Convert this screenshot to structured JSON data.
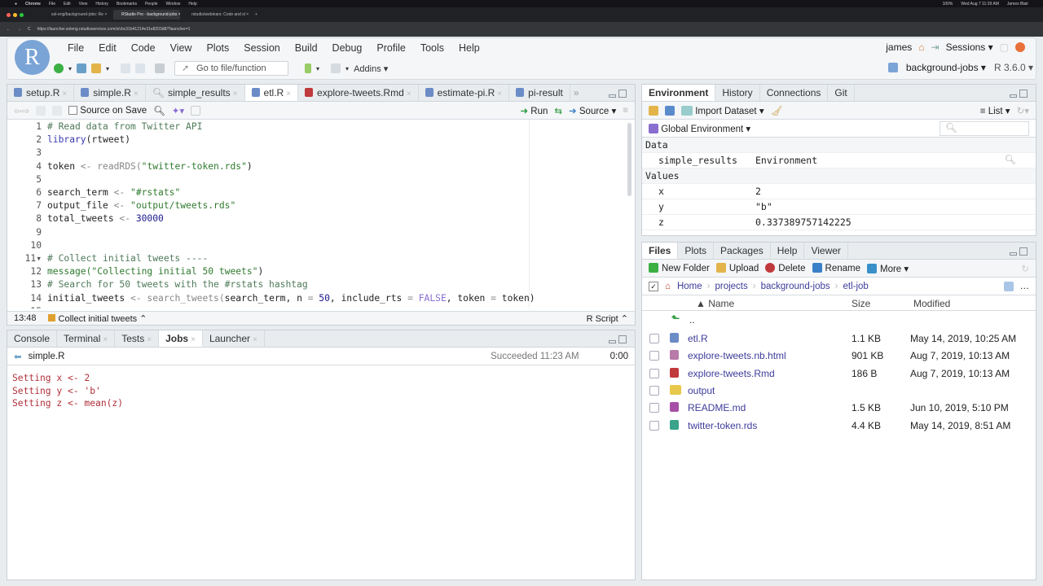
{
  "os": {
    "app": "Chrome",
    "menus": [
      "File",
      "Edit",
      "View",
      "History",
      "Bookmarks",
      "People",
      "Window",
      "Help"
    ],
    "clock": "Wed Aug 7  11:29 AM",
    "battery": "100%",
    "user": "James Blair"
  },
  "browser": {
    "tabs": [
      "sol-eng/background-jobs: Re",
      "RStudio Pro - background-jobs",
      "rstudio/webinars: Code and sl"
    ],
    "url": "https://launcher.soleng.rstudioservices.com/s/cbc31b41214e31e8203d8/?launcher=1"
  },
  "rstudio": {
    "logo": "R",
    "menus": [
      "File",
      "Edit",
      "Code",
      "View",
      "Plots",
      "Session",
      "Build",
      "Debug",
      "Profile",
      "Tools",
      "Help"
    ],
    "goto_placeholder": "Go to file/function",
    "addins": "Addins",
    "user": "james",
    "sessions": "Sessions",
    "project": "background-jobs",
    "r_version": "R 3.6.0"
  },
  "source": {
    "tabs": [
      "setup.R",
      "simple.R",
      "simple_results",
      "etl.R",
      "explore-tweets.Rmd",
      "estimate-pi.R",
      "pi-result"
    ],
    "active_tab": 3,
    "source_on_save": "Source on Save",
    "run": "Run",
    "source_btn": "Source",
    "lines": [
      [
        {
          "t": "# Read data from Twitter API",
          "c": "cm"
        }
      ],
      [
        {
          "t": "library",
          "c": "fn"
        },
        {
          "t": "(rtweet)",
          "c": ""
        }
      ],
      [],
      [
        {
          "t": "token ",
          "c": ""
        },
        {
          "t": "<- readRDS(",
          "c": "op"
        },
        {
          "t": "\"twitter-token.rds\"",
          "c": "st"
        },
        {
          "t": ")",
          "c": ""
        }
      ],
      [],
      [
        {
          "t": "search_term ",
          "c": ""
        },
        {
          "t": "<- ",
          "c": "op"
        },
        {
          "t": "\"#rstats\"",
          "c": "st"
        }
      ],
      [
        {
          "t": "output_file ",
          "c": ""
        },
        {
          "t": "<- ",
          "c": "op"
        },
        {
          "t": "\"output/tweets.rds\"",
          "c": "st"
        }
      ],
      [
        {
          "t": "total_tweets ",
          "c": ""
        },
        {
          "t": "<- ",
          "c": "op"
        },
        {
          "t": "30000",
          "c": "nu"
        }
      ],
      [],
      [],
      [
        {
          "t": "# Collect initial tweets ----",
          "c": "cm"
        }
      ],
      [
        {
          "t": "message(",
          "c": "st"
        },
        {
          "t": "\"Collecting initial 50 tweets\"",
          "c": "st"
        },
        {
          "t": ")",
          "c": ""
        }
      ],
      [
        {
          "t": "# Search for 50 tweets with the #rstats hashtag",
          "c": "cm"
        }
      ],
      [
        {
          "t": "initial_tweets ",
          "c": ""
        },
        {
          "t": "<- search_tweets(",
          "c": "op"
        },
        {
          "t": "search_term, n ",
          "c": ""
        },
        {
          "t": "= ",
          "c": "op"
        },
        {
          "t": "50",
          "c": "nu"
        },
        {
          "t": ", include_rts ",
          "c": ""
        },
        {
          "t": "= ",
          "c": "op"
        },
        {
          "t": "FALSE",
          "c": "kw"
        },
        {
          "t": ", token ",
          "c": ""
        },
        {
          "t": "= ",
          "c": "op"
        },
        {
          "t": "token)",
          "c": ""
        }
      ]
    ],
    "fold_line": 11,
    "status": {
      "position": "13:48",
      "section": "Collect initial tweets",
      "filetype": "R Script"
    }
  },
  "console": {
    "tabs": [
      "Console",
      "Terminal",
      "Tests",
      "Jobs",
      "Launcher"
    ],
    "active_tab": 3,
    "job_name": "simple.R",
    "job_status": "Succeeded 11:23 AM",
    "job_elapsed": "0:00",
    "output": [
      "Setting x <- 2",
      "Setting y <- 'b'",
      "Setting z <- mean(z)"
    ]
  },
  "environment": {
    "tabs": [
      "Environment",
      "History",
      "Connections",
      "Git"
    ],
    "import": "Import Dataset",
    "view": "List",
    "scope": "Global Environment",
    "sections": {
      "data": "Data",
      "values": "Values"
    },
    "data": [
      {
        "name": "simple_results",
        "value": "Environment"
      }
    ],
    "values": [
      {
        "name": "x",
        "value": "2"
      },
      {
        "name": "y",
        "value": "\"b\""
      },
      {
        "name": "z",
        "value": "0.337389757142225"
      }
    ]
  },
  "files": {
    "tabs": [
      "Files",
      "Plots",
      "Packages",
      "Help",
      "Viewer"
    ],
    "actions": [
      "New Folder",
      "Upload",
      "Delete",
      "Rename",
      "More"
    ],
    "breadcrumb": [
      "Home",
      "projects",
      "background-jobs",
      "etl-job"
    ],
    "columns": [
      "Name",
      "Size",
      "Modified"
    ],
    "up": "..",
    "rows": [
      {
        "name": "etl.R",
        "size": "1.1 KB",
        "modified": "May 14, 2019, 10:25 AM",
        "icon": "r-file",
        "color": "#6b8cc7"
      },
      {
        "name": "explore-tweets.nb.html",
        "size": "901 KB",
        "modified": "Aug 7, 2019, 10:13 AM",
        "icon": "notebook",
        "color": "#b87aa8"
      },
      {
        "name": "explore-tweets.Rmd",
        "size": "186 B",
        "modified": "Aug 7, 2019, 10:13 AM",
        "icon": "rmd",
        "color": "#c0393b"
      },
      {
        "name": "output",
        "size": "",
        "modified": "",
        "icon": "folder",
        "color": "#e8c84a"
      },
      {
        "name": "README.md",
        "size": "1.5 KB",
        "modified": "Jun 10, 2019, 5:10 PM",
        "icon": "md",
        "color": "#a64fa6"
      },
      {
        "name": "twitter-token.rds",
        "size": "4.4 KB",
        "modified": "May 14, 2019, 8:51 AM",
        "icon": "rds",
        "color": "#3aa38a"
      }
    ]
  }
}
